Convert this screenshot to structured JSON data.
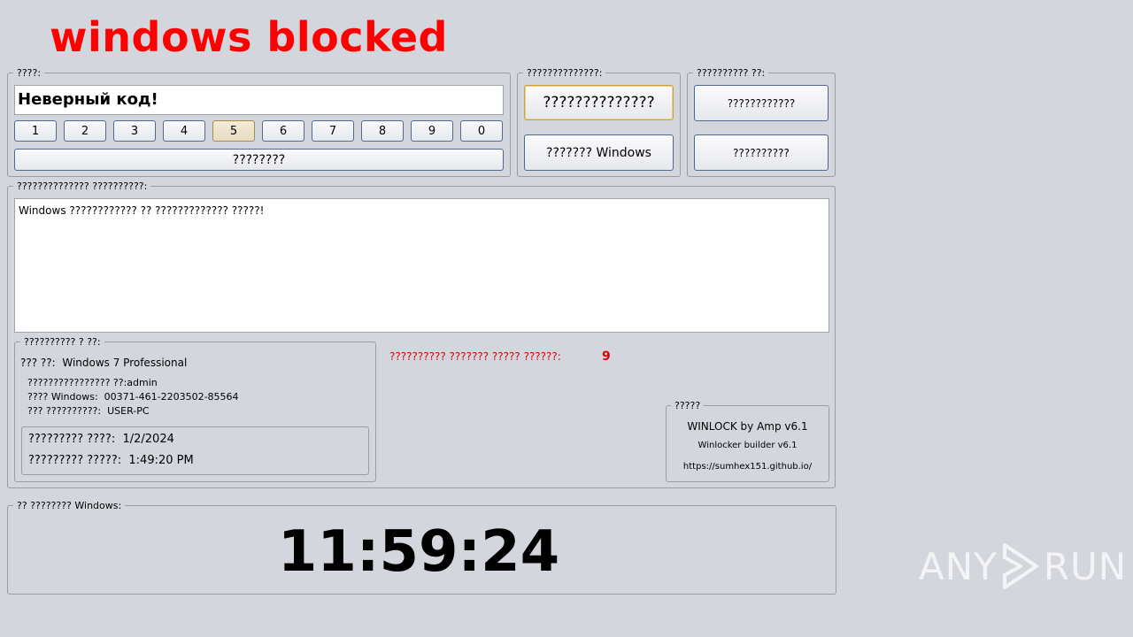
{
  "title": "windows blocked",
  "code_group": {
    "legend": "????:",
    "input_value": "Неверный код!",
    "keys": [
      "1",
      "2",
      "3",
      "4",
      "5",
      "6",
      "7",
      "8",
      "9",
      "0"
    ],
    "submit_label": "????????"
  },
  "actions_group": {
    "legend": "??????????????:",
    "primary_label": "??????????????",
    "secondary_label": "??????? Windows"
  },
  "extra_group": {
    "legend": "?????????? ??:",
    "button1_label": "????????????",
    "button2_label": "??????????"
  },
  "message_group": {
    "legend": "?????????????? ??????????:",
    "message_text": "Windows ???????????? ?? ????????????? ?????!"
  },
  "sysinfo_group": {
    "legend": "?????????? ? ??:",
    "os_label": "??? ??:",
    "os_value": "Windows 7 Professional",
    "user_label": "???????????????? ??:",
    "user_value": "admin",
    "key_label": "???? Windows:",
    "key_value": "00371-461-2203502-85564",
    "pc_label": "??? ??????????:",
    "pc_value": "USER-PC",
    "date_label": "????????? ????:",
    "date_value": "1/2/2024",
    "time_label": "????????? ?????:",
    "time_value": "1:49:20 PM"
  },
  "attempts": {
    "label": "?????????? ??????? ????? ??????:",
    "count": "9"
  },
  "credits_group": {
    "legend": "?????",
    "line1": "WINLOCK by Amp v6.1",
    "line2": "Winlocker builder v6.1",
    "line3": "https://sumhex151.github.io/"
  },
  "timer_group": {
    "legend": "?? ???????? Windows:",
    "time": "11:59:24"
  },
  "watermark": {
    "left": "ANY",
    "right": "RUN"
  }
}
